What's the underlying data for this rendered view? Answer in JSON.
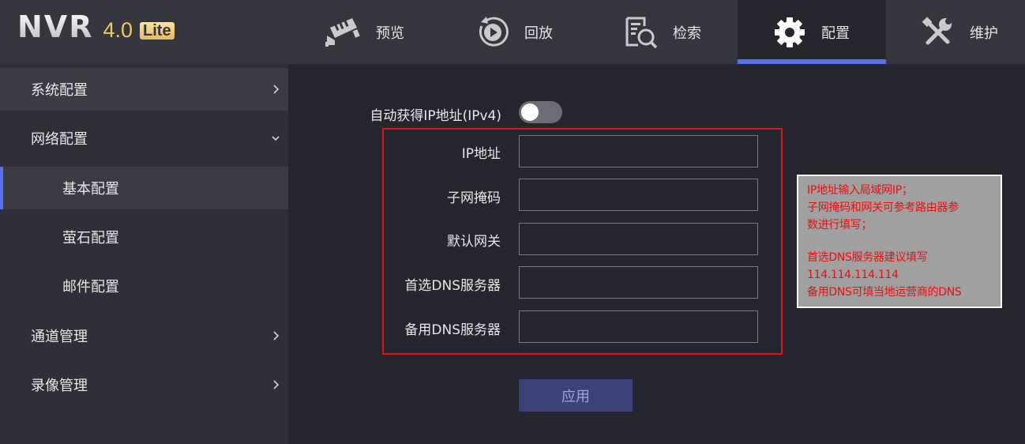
{
  "brand": {
    "name": "NVR",
    "version": "4.0",
    "edition": "Lite"
  },
  "nav": [
    {
      "label": "预览",
      "icon": "camera-icon"
    },
    {
      "label": "回放",
      "icon": "playback-icon"
    },
    {
      "label": "检索",
      "icon": "search-file-icon"
    },
    {
      "label": "配置",
      "icon": "gear-icon"
    },
    {
      "label": "维护",
      "icon": "tools-icon"
    }
  ],
  "active_nav": "配置",
  "sidebar": {
    "items": [
      {
        "label": "系统配置",
        "chevron": "right"
      },
      {
        "label": "网络配置",
        "chevron": "down"
      },
      {
        "label": "基本配置"
      },
      {
        "label": "萤石配置"
      },
      {
        "label": "邮件配置"
      },
      {
        "label": "通道管理",
        "chevron": "right"
      },
      {
        "label": "录像管理",
        "chevron": "right"
      }
    ],
    "active": "基本配置"
  },
  "form": {
    "dhcp_label": "自动获得IP地址(IPv4)",
    "dhcp_enabled": false,
    "fields": [
      {
        "label": "IP地址",
        "value": ""
      },
      {
        "label": "子网掩码",
        "value": ""
      },
      {
        "label": "默认网关",
        "value": ""
      },
      {
        "label": "首选DNS服务器",
        "value": ""
      },
      {
        "label": "备用DNS服务器",
        "value": ""
      }
    ],
    "apply_label": "应用"
  },
  "note": {
    "lines": [
      "IP地址输入局域网IP；",
      "子网掩码和网关可参考路由器参",
      "数进行填写；",
      "",
      "首选DNS服务器建议填写",
      "114.114.114.114",
      "备用DNS可填当地运营商的DNS"
    ]
  },
  "colors": {
    "accent": "#5a72e8",
    "header_bg": "#35363e",
    "sidebar_bg": "#2f3037",
    "main_bg": "#25262d",
    "highlight_border": "#d4191c",
    "note_text": "#e81010",
    "note_bg": "#a0a0a0"
  }
}
